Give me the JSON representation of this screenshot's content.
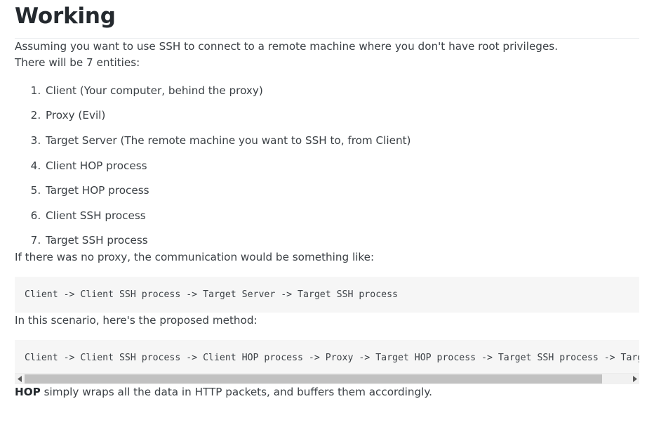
{
  "page": {
    "title": "Working",
    "intro_paragraph": "Assuming you want to use SSH to connect to a remote machine where you don't have root privileges.",
    "entities_intro": "There will be 7 entities:",
    "entities": [
      "Client (Your computer, behind the proxy)",
      "Proxy (Evil)",
      "Target Server (The remote machine you want to SSH to, from Client)",
      "Client HOP process",
      "Target HOP process",
      "Client SSH process",
      "Target SSH process"
    ],
    "no_proxy_paragraph": "If there was no proxy, the communication would be something like:",
    "code_no_proxy": "Client -> Client SSH process -> Target Server -> Target SSH process",
    "scenario_paragraph": "In this scenario, here's the proposed method:",
    "code_proposed": "Client -> Client SSH process -> Client HOP process -> Proxy -> Target HOP process -> Target SSH process -> Target Server",
    "hop_bold": "HOP",
    "hop_rest": " simply wraps all the data in HTTP packets, and buffers them accordingly.",
    "scrollbar": {
      "left_arrow": "scroll-left-arrow-icon",
      "right_arrow": "scroll-right-arrow-icon"
    },
    "colors": {
      "text": "#3b4045",
      "heading": "#24292e",
      "rule": "#eaecef",
      "code_bg": "#f6f6f6",
      "scroll_thumb": "#c1c1c1",
      "scroll_track": "#f1f1f1"
    }
  }
}
